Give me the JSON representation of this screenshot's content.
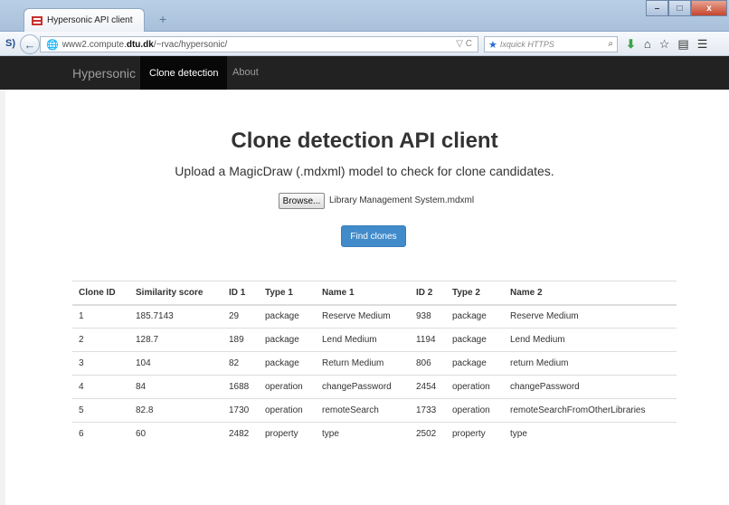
{
  "browser": {
    "tab_title": "Hypersonic API client",
    "new_tab_glyph": "+",
    "window_buttons": {
      "minimize": "–",
      "maximize": "□",
      "close": "x"
    },
    "url_host": "www2.compute.",
    "url_bold": "dtu.dk",
    "url_path": "/~rvac/hypersonic/",
    "url_right_icons": "▽ C",
    "search_placeholder": "Ixquick HTTPS",
    "s_icon": "S)",
    "icons": [
      "back-icon",
      "globe-icon",
      "search-icon",
      "download-icon",
      "home-icon",
      "bookmark-star-icon",
      "clipboard-icon",
      "menu-icon"
    ]
  },
  "site_nav": {
    "brand": "Hypersonic",
    "items": [
      {
        "label": "Clone detection",
        "active": true
      },
      {
        "label": "About",
        "active": false
      }
    ]
  },
  "main": {
    "title": "Clone detection API client",
    "subtitle": "Upload a MagicDraw (.mdxml) model to check for clone candidates.",
    "browse_label": "Browse...",
    "file_name": "Library Management System.mdxml",
    "find_button": "Find clones"
  },
  "table": {
    "headers": [
      "Clone ID",
      "Similarity score",
      "ID 1",
      "Type 1",
      "Name 1",
      "ID 2",
      "Type 2",
      "Name 2"
    ],
    "rows": [
      [
        "1",
        "185.7143",
        "29",
        "package",
        "Reserve Medium",
        "938",
        "package",
        "Reserve Medium"
      ],
      [
        "2",
        "128.7",
        "189",
        "package",
        "Lend Medium",
        "1194",
        "package",
        "Lend Medium"
      ],
      [
        "3",
        "104",
        "82",
        "package",
        "Return Medium",
        "806",
        "package",
        "return Medium"
      ],
      [
        "4",
        "84",
        "1688",
        "operation",
        "changePassword",
        "2454",
        "operation",
        "changePassword"
      ],
      [
        "5",
        "82.8",
        "1730",
        "operation",
        "remoteSearch",
        "1733",
        "operation",
        "remoteSearchFromOtherLibraries"
      ],
      [
        "6",
        "60",
        "2482",
        "property",
        "type",
        "2502",
        "property",
        "type"
      ]
    ]
  },
  "colors": {
    "navbar_bg": "#222222",
    "primary_button": "#428bca"
  }
}
